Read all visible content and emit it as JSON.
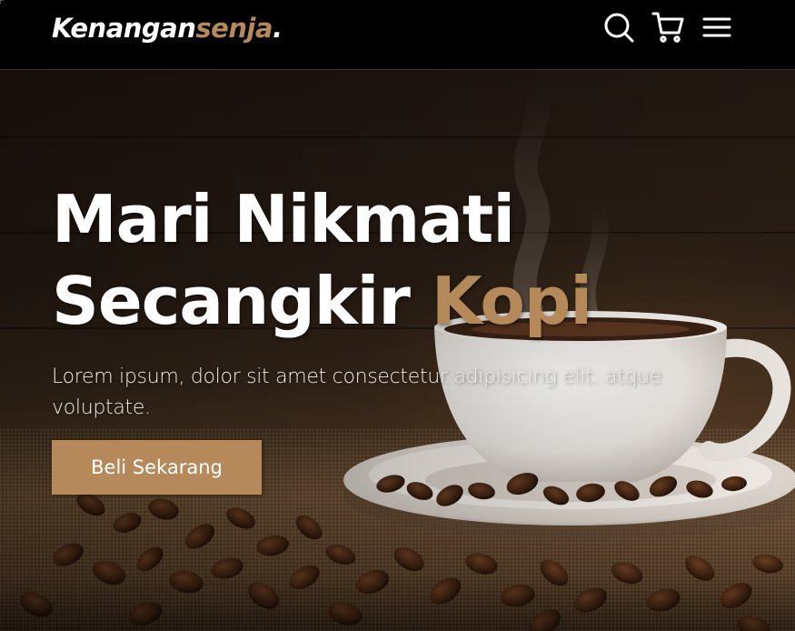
{
  "navbar": {
    "brand_main": "Kenangan",
    "brand_accent": "senja",
    "brand_dot": ".",
    "icons": [
      "search-icon",
      "shopping-cart-icon",
      "menu-icon"
    ]
  },
  "hero": {
    "title_line1": "Mari Nikmati",
    "title_line2_main": "Secangkir ",
    "title_line2_accent": "Kopi",
    "text": "Lorem ipsum, dolor sit amet consectetur adipisicing elit. atque voluptate.",
    "cta_label": "Beli Sekarang"
  },
  "colors": {
    "accent": "#b6895b",
    "navbar_bg": "#000000",
    "text": "#ffffff"
  }
}
